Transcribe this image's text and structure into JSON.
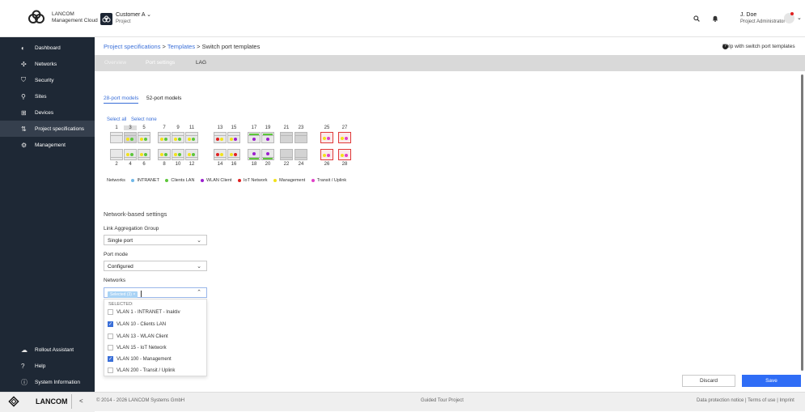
{
  "brand": {
    "line1": "LANCOM",
    "line2": "Management Cloud"
  },
  "customer": {
    "name": "Customer A",
    "sub": "Project"
  },
  "user": {
    "name": "J. Doe",
    "role": "Project Administrator"
  },
  "sidebar": {
    "items": [
      {
        "label": "Dashboard",
        "icon": "dashboard-icon"
      },
      {
        "label": "Networks",
        "icon": "networks-icon"
      },
      {
        "label": "Security",
        "icon": "shield-icon"
      },
      {
        "label": "Sites",
        "icon": "sites-icon"
      },
      {
        "label": "Devices",
        "icon": "devices-icon"
      },
      {
        "label": "Project specifications",
        "icon": "specifications-icon"
      },
      {
        "label": "Management",
        "icon": "management-icon"
      }
    ],
    "bottom_items": [
      {
        "label": "Rollout Assistant",
        "icon": "rollout-icon"
      },
      {
        "label": "Help",
        "icon": "help-icon"
      },
      {
        "label": "System Information",
        "icon": "info-icon"
      }
    ]
  },
  "breadcrumb": {
    "part1": "Project specifications",
    "sep1": ">",
    "part2": "Templates",
    "sep2": ">",
    "current": "Switch port templates"
  },
  "help_link": "Help with switch port templates",
  "tabs": {
    "overview": "Overview",
    "port_settings": "Port settings",
    "lag": "LAG"
  },
  "subtabs": {
    "models28": "28-port models",
    "models52": "52-port models"
  },
  "select": {
    "all": "Select all",
    "none": "Select none"
  },
  "ports_top": [
    "1",
    "3",
    "5",
    "7",
    "9",
    "11",
    "13",
    "15",
    "17",
    "19",
    "21",
    "23",
    "25",
    "27"
  ],
  "ports_bottom": [
    "2",
    "4",
    "6",
    "8",
    "10",
    "12",
    "14",
    "16",
    "18",
    "20",
    "22",
    "24",
    "26",
    "28"
  ],
  "legend": {
    "title": "Networks",
    "items": [
      {
        "label": "INTRANET",
        "color": "#6fb8e8"
      },
      {
        "label": "Clients LAN",
        "color": "#5cc63a"
      },
      {
        "label": "WLAN Client",
        "color": "#9c1fcf"
      },
      {
        "label": "IoT Network",
        "color": "#e02020"
      },
      {
        "label": "Management",
        "color": "#f2e21a"
      },
      {
        "label": "Transit / Uplink",
        "color": "#e040c8"
      }
    ]
  },
  "settings": {
    "title": "Network-based settings",
    "lag_label": "Link Aggregation Group",
    "lag_value": "Single port",
    "mode_label": "Port mode",
    "mode_value": "Configured",
    "networks_label": "Networks",
    "networks_chip": "Selected (3)",
    "chip_close": "×"
  },
  "dropdown": {
    "selected_label": "SELECTED:",
    "options": [
      {
        "label": "VLAN 1 - INTRANET - Inaktiv",
        "checked": false
      },
      {
        "label": "VLAN 10 - Clients LAN",
        "checked": true
      },
      {
        "label": "VLAN 13 - WLAN Client",
        "checked": false
      },
      {
        "label": "VLAN 15 - IoT Network",
        "checked": false
      },
      {
        "label": "VLAN 100 - Management",
        "checked": true
      },
      {
        "label": "VLAN 200 - Transit / Uplink",
        "checked": false
      }
    ]
  },
  "buttons": {
    "discard": "Discard",
    "save": "Save"
  },
  "footer": {
    "copyright": "© 2014 - 2026 LANCOM Systems GmbH",
    "project": "Guided Tour Project",
    "privacy": "Data protection notice",
    "sep": "|",
    "terms": "Terms of use",
    "imprint": "Imprint",
    "brand": "LANCOM",
    "collapse": "<"
  },
  "colors": {
    "accent": "#3a6fd8",
    "save": "#2f6df6",
    "sidebar": "#1e2835",
    "sfp_border": "#e03a3a"
  }
}
